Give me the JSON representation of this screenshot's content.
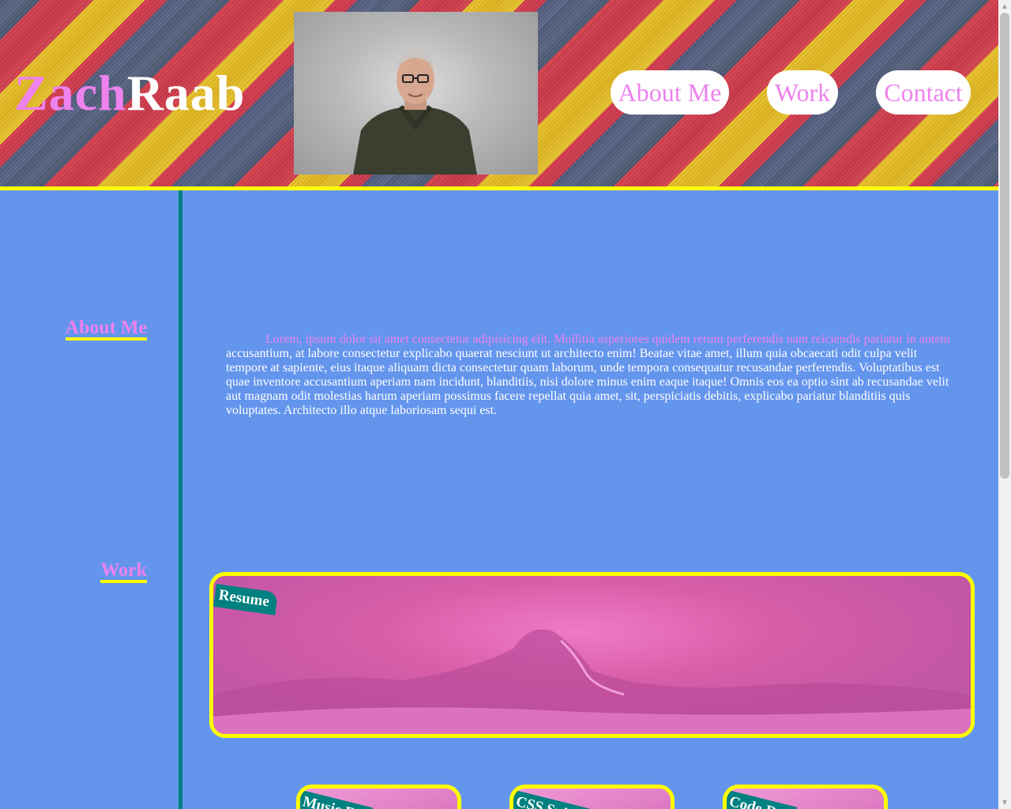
{
  "header": {
    "logo_first": "Zach",
    "logo_last": "Raab",
    "portrait_alt": "Portrait photo"
  },
  "nav": {
    "items": [
      {
        "label": "About Me"
      },
      {
        "label": "Work"
      },
      {
        "label": "Contact"
      }
    ]
  },
  "sidebar": {
    "items": [
      {
        "label": "About Me"
      },
      {
        "label": "Work"
      }
    ]
  },
  "about": {
    "highlight": "Lorem, ipsum dolor sit amet consectetur adipisicing elit. Mollitia asperiores quidem rerum perferendis nam reiciendis pariatur in autem",
    "body": "accusantium, at labore consectetur explicabo quaerat nesciunt ut architecto enim! Beatae vitae amet, illum quia obcaecati odit culpa velit tempore at sapiente, eius itaque aliquam dicta consectetur quam laborum, unde tempora consequatur recusandae perferendis. Voluptatibus est quae inventore accusantium aperiam nam incidunt, blanditiis, nisi dolore minus enim eaque itaque! Omnis eos ea optio sint ab recusandae velit aut magnam odit molestias harum aperiam possimus facere repellat quia amet, sit, perspiciatis debitis, explicabo pariatur blanditiis quis voluptates. Architecto illo atque laboriosam sequi est."
  },
  "work": {
    "featured": {
      "label": "Resume"
    },
    "cards": [
      {
        "label": "Music F..."
      },
      {
        "label": "CSS Spin..."
      },
      {
        "label": "Code D..."
      }
    ]
  },
  "colors": {
    "background": "#6495ed",
    "accent": "#ee82ee",
    "border": "#ffff00",
    "divider": "#008080"
  }
}
